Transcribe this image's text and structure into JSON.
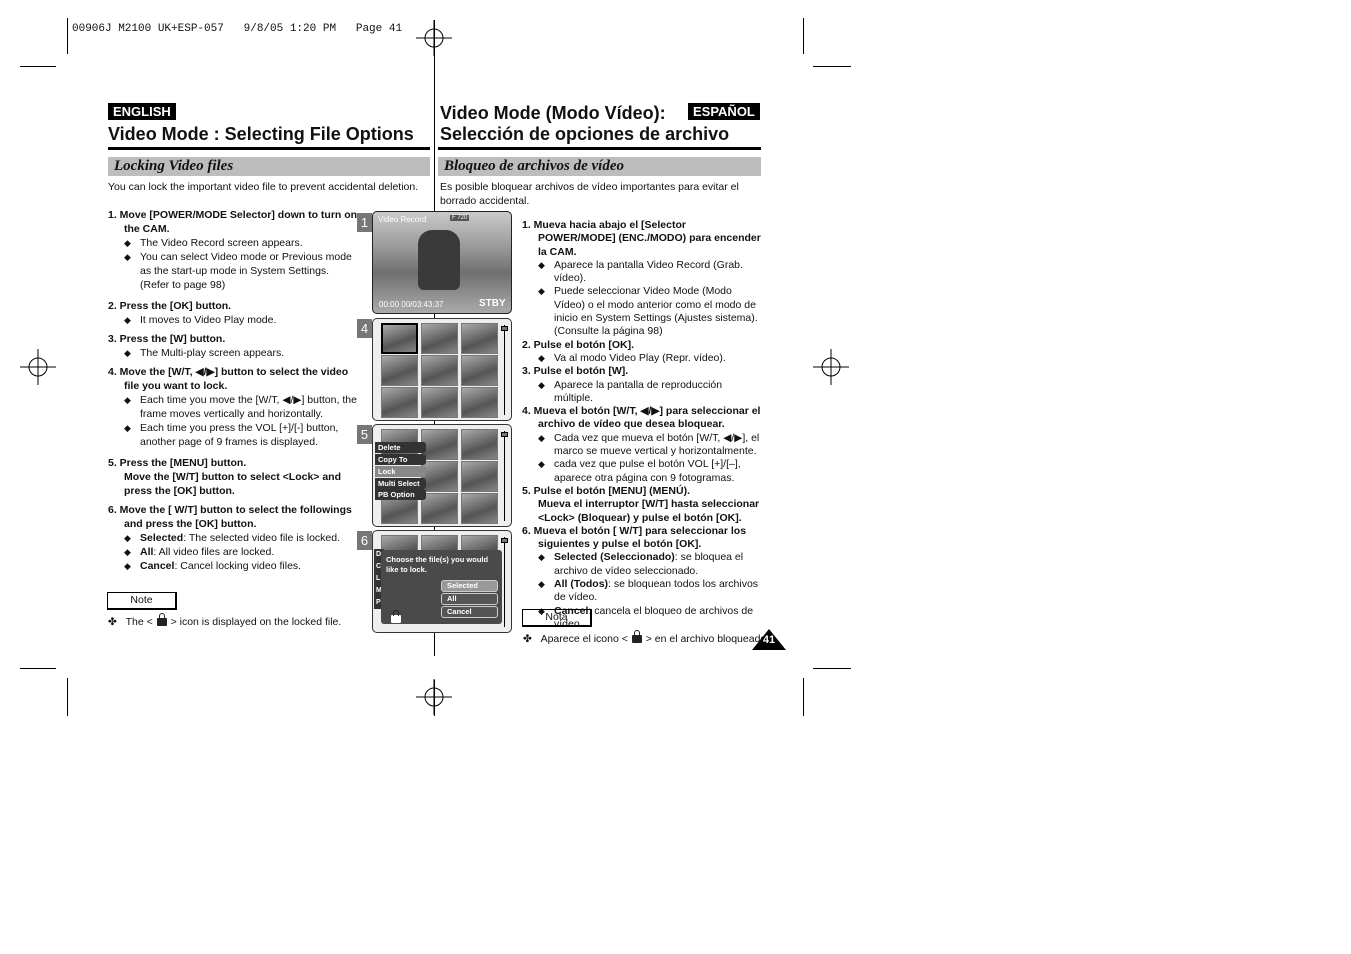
{
  "slug": "00906J M2100 UK+ESP-057   9/8/05 1:20 PM   Page 41",
  "english": {
    "lang_badge": "ENGLISH",
    "title": "Video Mode : Selecting File Options",
    "section": "Locking Video files",
    "intro": "You can lock the important video file to prevent accidental deletion.",
    "steps": [
      {
        "head": "1.  Move [POWER/MODE Selector] down to turn on the CAM.",
        "bullets": [
          "The Video Record screen appears.",
          "You can select Video mode or Previous mode as the start-up mode in System Settings. (Refer to page 98)"
        ]
      },
      {
        "head": "2.  Press the [OK] button.",
        "bullets": [
          "It moves to Video Play mode."
        ]
      },
      {
        "head": "3.  Press the [W] button.",
        "bullets": [
          "The Multi-play screen appears."
        ]
      },
      {
        "head": "4.  Move the [W/T, ◀/▶] button to select the video file you want to lock.",
        "bullets": [
          "Each time you move the [W/T, ◀/▶] button, the frame moves vertically and horizontally.",
          "Each time you press the VOL [+]/[-] button, another page of 9 frames is displayed."
        ]
      },
      {
        "head": "5.  Press the [MENU] button.",
        "head2": "Move the [W/T] button to select <Lock> and press the [OK] button."
      },
      {
        "head": "6.  Move the [ W/T] button to select the followings and press the [OK] button.",
        "bullets": [
          {
            "term": "Selected",
            "desc": ": The selected video file is locked."
          },
          {
            "term": "All",
            "desc": ": All video files are locked."
          },
          {
            "term": "Cancel",
            "desc": ": Cancel locking video files."
          }
        ]
      }
    ],
    "note_label": "Note",
    "note_pre": "The <",
    "note_post": "> icon is displayed on the locked file."
  },
  "spanish": {
    "lang_badge": "ESPAÑOL",
    "title_line1": "Video Mode (Modo Vídeo):",
    "title_line2": "Selección de opciones de archivo",
    "section": "Bloqueo de archivos de vídeo",
    "intro": "Es posible bloquear archivos de vídeo importantes para evitar el borrado accidental.",
    "steps": [
      {
        "head": "1.  Mueva hacia abajo el [Selector POWER/MODE] (ENC./MODO) para encender la CAM.",
        "bullets": [
          "Aparece la pantalla Video Record (Grab. vídeo).",
          "Puede seleccionar Video Mode (Modo Vídeo) o el modo anterior como el modo de inicio en System Settings (Ajustes sistema). (Consulte la página 98)"
        ]
      },
      {
        "head": "2.  Pulse el botón [OK].",
        "bullets": [
          "Va al modo Video Play (Repr. vídeo)."
        ]
      },
      {
        "head": "3.  Pulse el botón [W].",
        "bullets": [
          "Aparece la pantalla de reproducción múltiple."
        ]
      },
      {
        "head": "4.  Mueva el botón [W/T, ◀/▶] para seleccionar el archivo de vídeo que desea bloquear.",
        "bullets": [
          "Cada vez que mueva el botón [W/T, ◀/▶], el marco se mueve vertical y horizontalmente.",
          "cada vez que pulse el botón VOL [+]/[–], aparece otra página con 9 fotogramas."
        ]
      },
      {
        "head": "5.  Pulse el botón [MENU] (MENÚ).",
        "head2": "Mueva el interruptor [W/T] hasta seleccionar <Lock> (Bloquear) y pulse el botón [OK]."
      },
      {
        "head": "6.  Mueva el botón [ W/T] para seleccionar los siguientes y pulse el botón [OK].",
        "bullets": [
          {
            "term": "Selected (Seleccionado)",
            "desc": ": se bloquea el archivo de vídeo seleccionado."
          },
          {
            "term": "All (Todos)",
            "desc": ": se bloquean todos los archivos de vídeo."
          },
          {
            "term": "Cancel",
            "desc": ": cancela el bloqueo de archivos de vídeo."
          }
        ]
      }
    ],
    "note_label": "Nota",
    "note_pre": "Aparece el icono <",
    "note_post": "> en el archivo bloqueado."
  },
  "page_number": "41",
  "screens": {
    "s1": {
      "num": "1",
      "mode": "Video Record",
      "quality": "F 720",
      "counter": "00:00 00/03:43:37",
      "status": "STBY"
    },
    "s4": {
      "num": "4"
    },
    "s5": {
      "num": "5",
      "menu": [
        "Delete",
        "Copy To",
        "Lock",
        "Multi Select",
        "PB Option"
      ]
    },
    "s6": {
      "num": "6",
      "menu_letters": [
        "D",
        "C",
        "L",
        "M",
        "P"
      ],
      "prompt": "Choose the file(s) you would like to lock.",
      "options": [
        "Selected",
        "All",
        "Cancel"
      ]
    }
  },
  "note_bullet": "✤"
}
